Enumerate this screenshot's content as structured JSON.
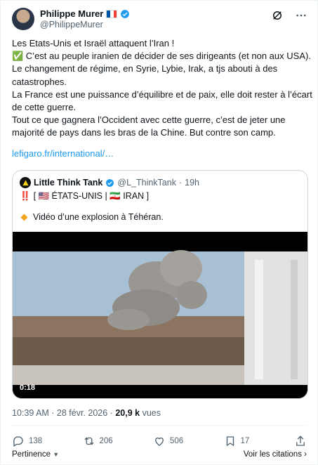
{
  "author": {
    "name": "Philippe Murer",
    "handle": "@PhilippeMurer",
    "flag": "french-flag",
    "verified": true
  },
  "tweet": {
    "lines": [
      "Les Etats-Unis et Israël attaquent l’Iran !",
      "✅ C’est au peuple iranien de décider de ses dirigeants (et non aux USA).",
      "Le changement de régime, en Syrie, Lybie, Irak, a tjs abouti à des catastrophes.",
      "La France est une puissance d’équilibre et de paix, elle doit rester à l’écart de cette guerre.",
      "Tout ce que gagnera l’Occident avec cette guerre, c’est de jeter une majorité de pays dans les bras de la  Chine. But contre son camp."
    ],
    "link": "lefigaro.fr/international/…"
  },
  "quote": {
    "name": "Little Think Tank",
    "handle": "@L_ThinkTank",
    "sep": "·",
    "time": "19h",
    "alert": "‼️",
    "line2": "[ 🇺🇸 ÉTATS-UNIS | 🇮🇷 IRAN ]",
    "text": "Vidéo d’une explosion à Téhéran.",
    "video_duration": "0:18"
  },
  "meta": {
    "time": "10:39 AM · 28 févr. 2026 ·",
    "views_count": "20,9 k",
    "views_label": "vues"
  },
  "actions": {
    "replies": "138",
    "reposts": "206",
    "likes": "506",
    "bookmarks": "17"
  },
  "footer": {
    "left": "Pertinence",
    "right": "Voir les citations"
  },
  "colors": {
    "accent": "#1d9bf0",
    "text": "#0f1419",
    "muted": "#536471"
  }
}
